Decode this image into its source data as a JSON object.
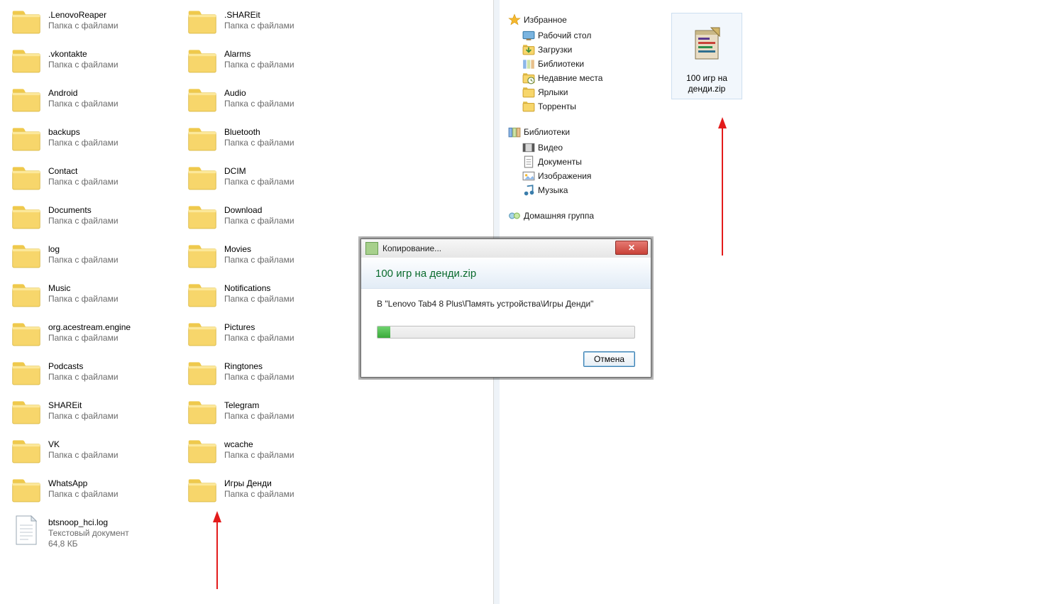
{
  "leftPane": {
    "folderSubtitle": "Папка с файлами",
    "col1": [
      ".LenovoReaper",
      ".vkontakte",
      "Android",
      "backups",
      "Contact",
      "Documents",
      "log",
      "Music",
      "org.acestream.engine",
      "Podcasts",
      "SHAREit",
      "VK",
      "WhatsApp"
    ],
    "col2": [
      ".SHAREit",
      "Alarms",
      "Audio",
      "Bluetooth",
      "DCIM",
      "Download",
      "Movies",
      "Notifications",
      "Pictures",
      "Ringtones",
      "Telegram",
      "wcache",
      "Игры Денди"
    ],
    "file": {
      "name": "btsnoop_hci.log",
      "type": "Текстовый документ",
      "size": "64,8 КБ"
    }
  },
  "tree": {
    "favorites": {
      "header": "Избранное",
      "items": [
        "Рабочий стол",
        "Загрузки",
        "Библиотеки",
        "Недавние места",
        "Ярлыки",
        "Торренты"
      ]
    },
    "libraries": {
      "header": "Библиотеки",
      "items": [
        "Видео",
        "Документы",
        "Изображения",
        "Музыка"
      ]
    },
    "homegroup": {
      "header": "Домашняя группа"
    }
  },
  "rightPane": {
    "zipFile": {
      "name": "100 игр на денди.zip"
    }
  },
  "dialog": {
    "title": "Копирование...",
    "filename": "100 игр на денди.zip",
    "destPrefix": "В ",
    "destPath": "\"Lenovo Tab4 8 Plus\\Память устройства\\Игры Денди\"",
    "cancel": "Отмена",
    "closeGlyph": "✕"
  }
}
